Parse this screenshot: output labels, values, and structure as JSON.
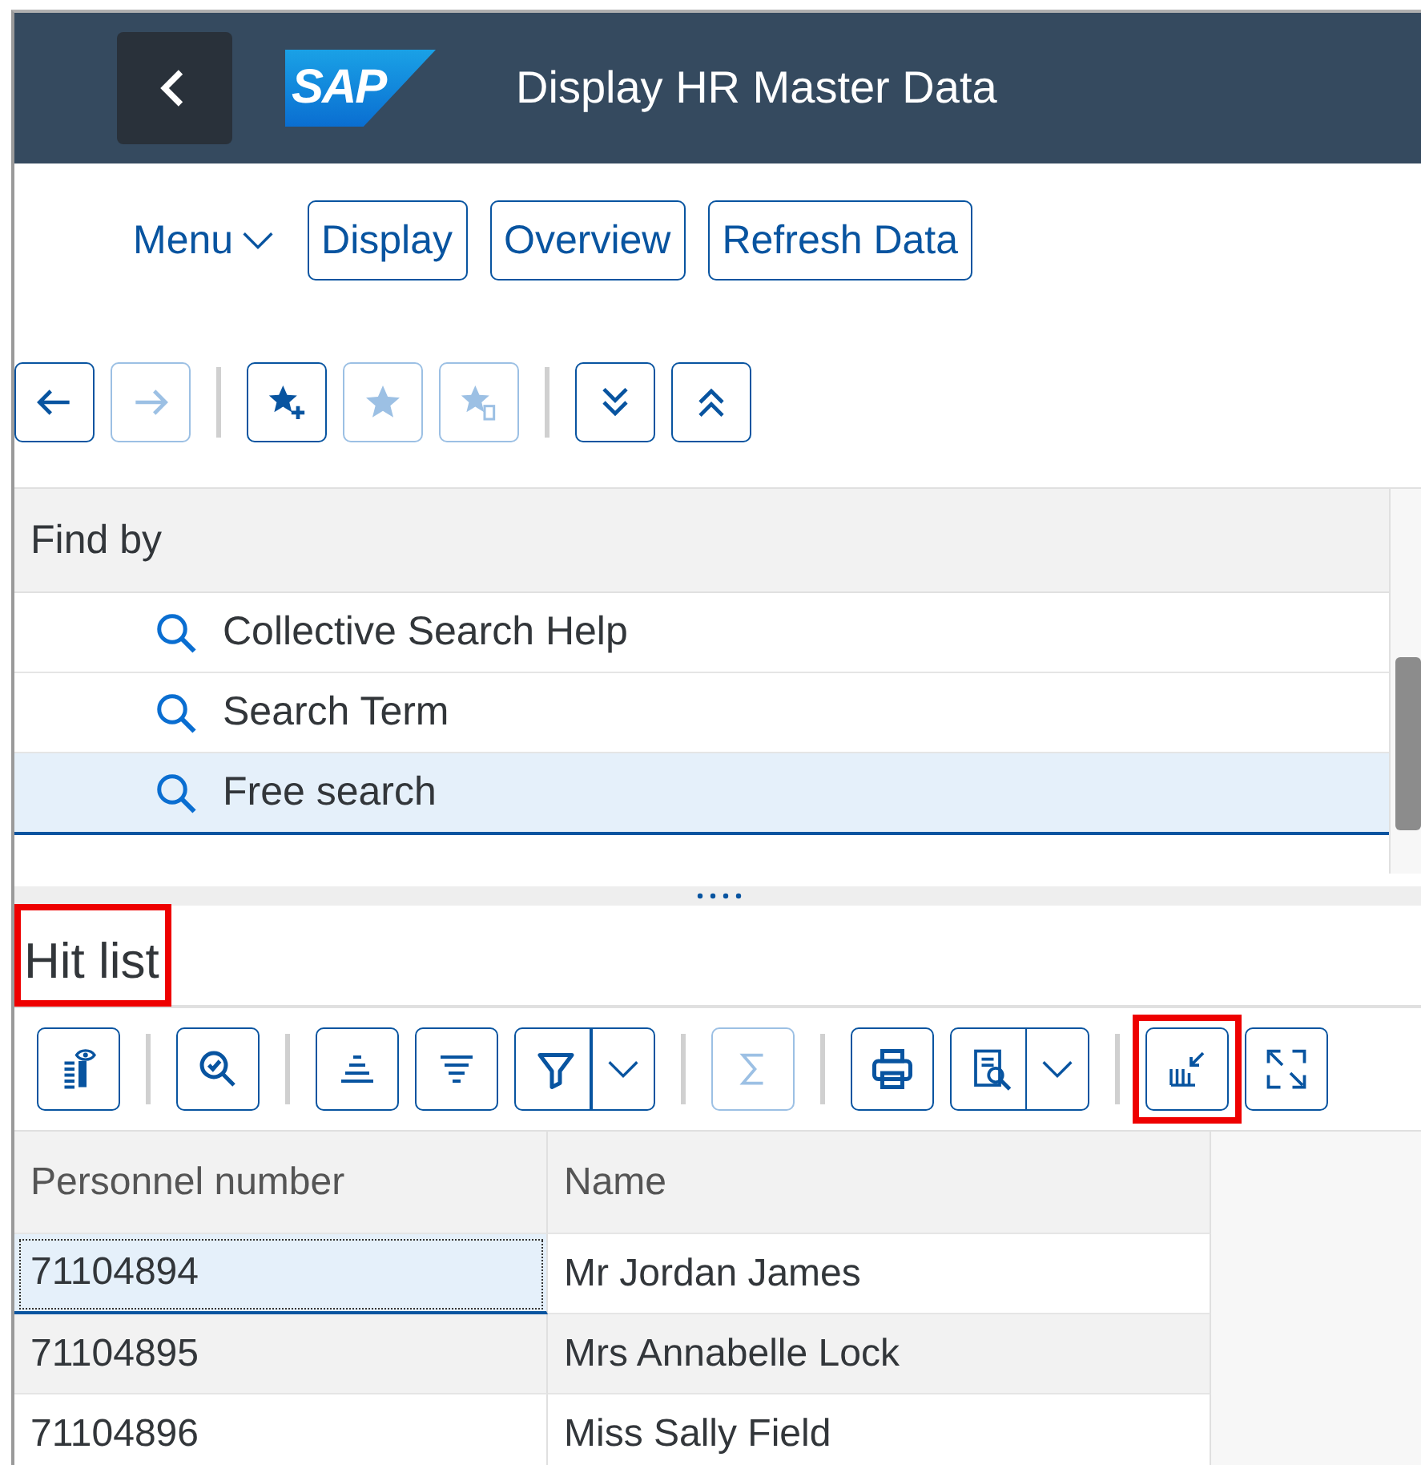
{
  "shell": {
    "logo": "SAP",
    "title": "Display HR Master Data"
  },
  "actions": {
    "menu": "Menu",
    "buttons": [
      "Display",
      "Overview",
      "Refresh Data"
    ]
  },
  "toolbar": [
    [
      {
        "kind": "back",
        "disabled": false
      },
      {
        "kind": "forward",
        "disabled": true
      }
    ],
    [
      {
        "kind": "addfav",
        "disabled": false
      },
      {
        "kind": "fav",
        "disabled": true
      },
      {
        "kind": "favdoc",
        "disabled": true
      }
    ],
    [
      {
        "kind": "expand",
        "disabled": false
      },
      {
        "kind": "collapse",
        "disabled": false
      }
    ]
  ],
  "find_panel": {
    "title": "Find by",
    "items": [
      {
        "label": "Collective Search Help",
        "selected": false
      },
      {
        "label": "Search Term",
        "selected": false
      },
      {
        "label": "Free search",
        "selected": true
      }
    ]
  },
  "hit_list": {
    "title": "Hit list",
    "highlighted": true,
    "toolbar": [
      [
        {
          "kind": "details",
          "disabled": false,
          "dropdown": false,
          "highlighted": false
        }
      ],
      [
        {
          "kind": "find",
          "disabled": false,
          "dropdown": false,
          "highlighted": false
        }
      ],
      [
        {
          "kind": "sortasc",
          "disabled": false,
          "dropdown": false,
          "highlighted": false
        },
        {
          "kind": "sortdesc",
          "disabled": false,
          "dropdown": false,
          "highlighted": false
        },
        {
          "kind": "filter",
          "disabled": false,
          "dropdown": true,
          "highlighted": false
        }
      ],
      [
        {
          "kind": "sum",
          "disabled": true,
          "dropdown": false,
          "highlighted": false
        }
      ],
      [
        {
          "kind": "print",
          "disabled": false,
          "dropdown": false,
          "highlighted": false
        },
        {
          "kind": "view",
          "disabled": false,
          "dropdown": true,
          "highlighted": false
        }
      ],
      [
        {
          "kind": "compress",
          "disabled": false,
          "dropdown": false,
          "highlighted": true
        },
        {
          "kind": "fullscreen",
          "disabled": false,
          "dropdown": false,
          "highlighted": false
        }
      ]
    ],
    "columns": [
      "Personnel number",
      "Name"
    ],
    "rows": [
      {
        "number": "71104894",
        "name": "Mr Jordan James",
        "selected": true
      },
      {
        "number": "71104895",
        "name": "Mrs Annabelle Lock",
        "selected": false
      },
      {
        "number": "71104896",
        "name": "Miss Sally Field",
        "selected": false
      }
    ]
  }
}
